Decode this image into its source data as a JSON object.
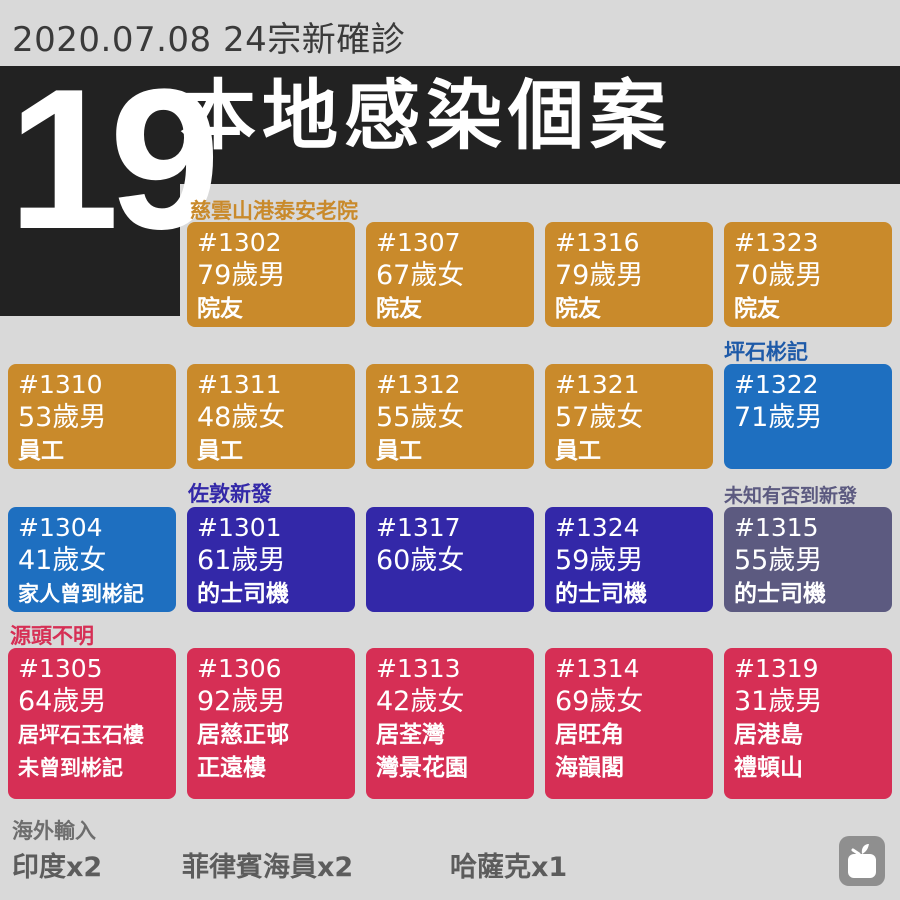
{
  "header": {
    "date_line": "2020.07.08  24宗新確診",
    "big_number": "19",
    "headline": "本地感染個案"
  },
  "groups": [
    {
      "label": "慈雲山港泰安老院",
      "color": "#c98a2b"
    },
    {
      "label": "坪石彬記",
      "color": "#1e6fc0"
    },
    {
      "label": "佐敦新發",
      "color": "#3328a8"
    },
    {
      "label": "未知有否到新發",
      "color": "#5c5a80"
    },
    {
      "label": "源頭不明",
      "color": "#d62f55"
    }
  ],
  "cards": [
    {
      "id": "#1302",
      "age": "79歲男",
      "note": "院友"
    },
    {
      "id": "#1307",
      "age": "67歲女",
      "note": "院友"
    },
    {
      "id": "#1316",
      "age": "79歲男",
      "note": "院友"
    },
    {
      "id": "#1323",
      "age": "70歲男",
      "note": "院友"
    },
    {
      "id": "#1310",
      "age": "53歲男",
      "note": "員工"
    },
    {
      "id": "#1311",
      "age": "48歲女",
      "note": "員工"
    },
    {
      "id": "#1312",
      "age": "55歲女",
      "note": "員工"
    },
    {
      "id": "#1321",
      "age": "57歲女",
      "note": "員工"
    },
    {
      "id": "#1322",
      "age": "71歲男",
      "note": ""
    },
    {
      "id": "#1304",
      "age": "41歲女",
      "note": "家人曾到彬記"
    },
    {
      "id": "#1301",
      "age": "61歲男",
      "note": "的士司機"
    },
    {
      "id": "#1317",
      "age": "60歲女",
      "note": ""
    },
    {
      "id": "#1324",
      "age": "59歲男",
      "note": "的士司機"
    },
    {
      "id": "#1315",
      "age": "55歲男",
      "note": "的士司機"
    },
    {
      "id": "#1305",
      "age": "64歲男",
      "note": "居坪石玉石樓",
      "note2": "未曾到彬記"
    },
    {
      "id": "#1306",
      "age": "92歲男",
      "note": "居慈正邨",
      "note2": "正遠樓"
    },
    {
      "id": "#1313",
      "age": "42歲女",
      "note": "居荃灣",
      "note2": "灣景花園"
    },
    {
      "id": "#1314",
      "age": "69歲女",
      "note": "居旺角",
      "note2": "海韻閣"
    },
    {
      "id": "#1319",
      "age": "31歲男",
      "note": "居港島",
      "note2": "禮頓山"
    }
  ],
  "imported": {
    "title": "海外輸入",
    "items": [
      "印度x2",
      "菲律賓海員x2",
      "哈薩克x1"
    ]
  },
  "logo_icon": "apple-daily-logo-icon"
}
